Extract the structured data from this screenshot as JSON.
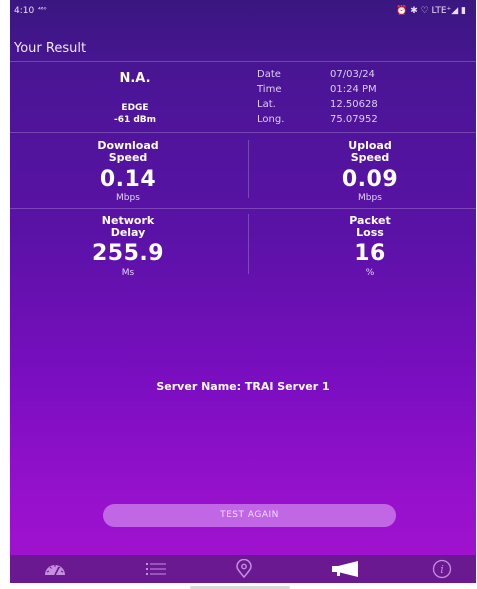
{
  "status_bar": {
    "time": "4:10",
    "left_icons": "⁴⁶⁰",
    "right_icons": "⏰ ✱ ♡ LTE⁺◢ ▮"
  },
  "header": {
    "title": "Your Result"
  },
  "info": {
    "operator": "N.A.",
    "network_type": "EDGE",
    "signal": "-61 dBm",
    "date_label": "Date",
    "date_value": "07/03/24",
    "time_label": "Time",
    "time_value": "01:24 PM",
    "lat_label": "Lat.",
    "lat_value": "12.50628",
    "long_label": "Long.",
    "long_value": "75.07952"
  },
  "metrics": {
    "download": {
      "label1": "Download",
      "label2": "Speed",
      "value": "0.14",
      "unit": "Mbps"
    },
    "upload": {
      "label1": "Upload",
      "label2": "Speed",
      "value": "0.09",
      "unit": "Mbps"
    },
    "delay": {
      "label1": "Network",
      "label2": "Delay",
      "value": "255.9",
      "unit": "Ms"
    },
    "loss": {
      "label1": "Packet",
      "label2": "Loss",
      "value": "16",
      "unit": "%"
    }
  },
  "server": {
    "name": "Server Name: TRAI Server 1"
  },
  "actions": {
    "test_again": "TEST AGAIN"
  },
  "nav": {
    "items": [
      "speedometer-icon",
      "list-icon",
      "location-pin-icon",
      "megaphone-icon",
      "info-icon"
    ],
    "active": "megaphone-icon"
  },
  "colors": {
    "accent_button": "#c167e6",
    "navbar": "#6b1990",
    "bg_top": "#3a1780",
    "bg_bottom": "#a312d0"
  }
}
